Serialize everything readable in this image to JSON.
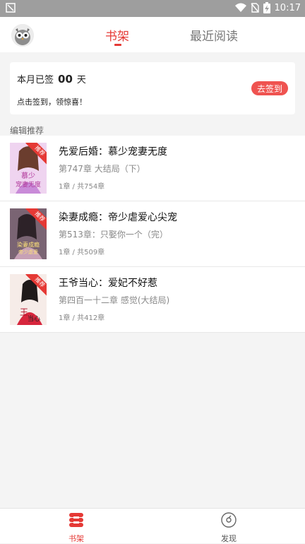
{
  "status_bar": {
    "time": "10:17"
  },
  "header": {
    "tabs": [
      {
        "label": "书架",
        "active": true
      },
      {
        "label": "最近阅读",
        "active": false
      }
    ]
  },
  "sign_in": {
    "prefix": "本月已签",
    "days": "00",
    "suffix": "天",
    "hint": "点击签到，领惊喜！",
    "button_label": "去签到"
  },
  "section": {
    "title": "编辑推荐"
  },
  "books": [
    {
      "title": "先爱后婚：慕少宠妻无度",
      "chapter": "第747章 大结局（下）",
      "progress": "1章 / 共754章",
      "badge": "推荐",
      "cover_color": "#e9c9ee"
    },
    {
      "title": "染妻成瘾：帝少虐爱心尖宠",
      "chapter": "第513章：只娶你一个（完）",
      "progress": "1章 / 共509章",
      "badge": "推荐",
      "cover_color": "#9a7b8e"
    },
    {
      "title": "王爷当心：爱妃不好惹",
      "chapter": "第四百一十二章 感觉(大结局)",
      "progress": "1章 / 共412章",
      "badge": "推荐",
      "cover_color": "#f2e6e1"
    }
  ],
  "bottom_nav": {
    "items": [
      {
        "label": "书架",
        "active": true,
        "icon": "bookshelf-icon"
      },
      {
        "label": "发现",
        "active": false,
        "icon": "discover-icon"
      }
    ]
  },
  "colors": {
    "accent": "#e53935",
    "status_bar": "#9e9e9e"
  }
}
